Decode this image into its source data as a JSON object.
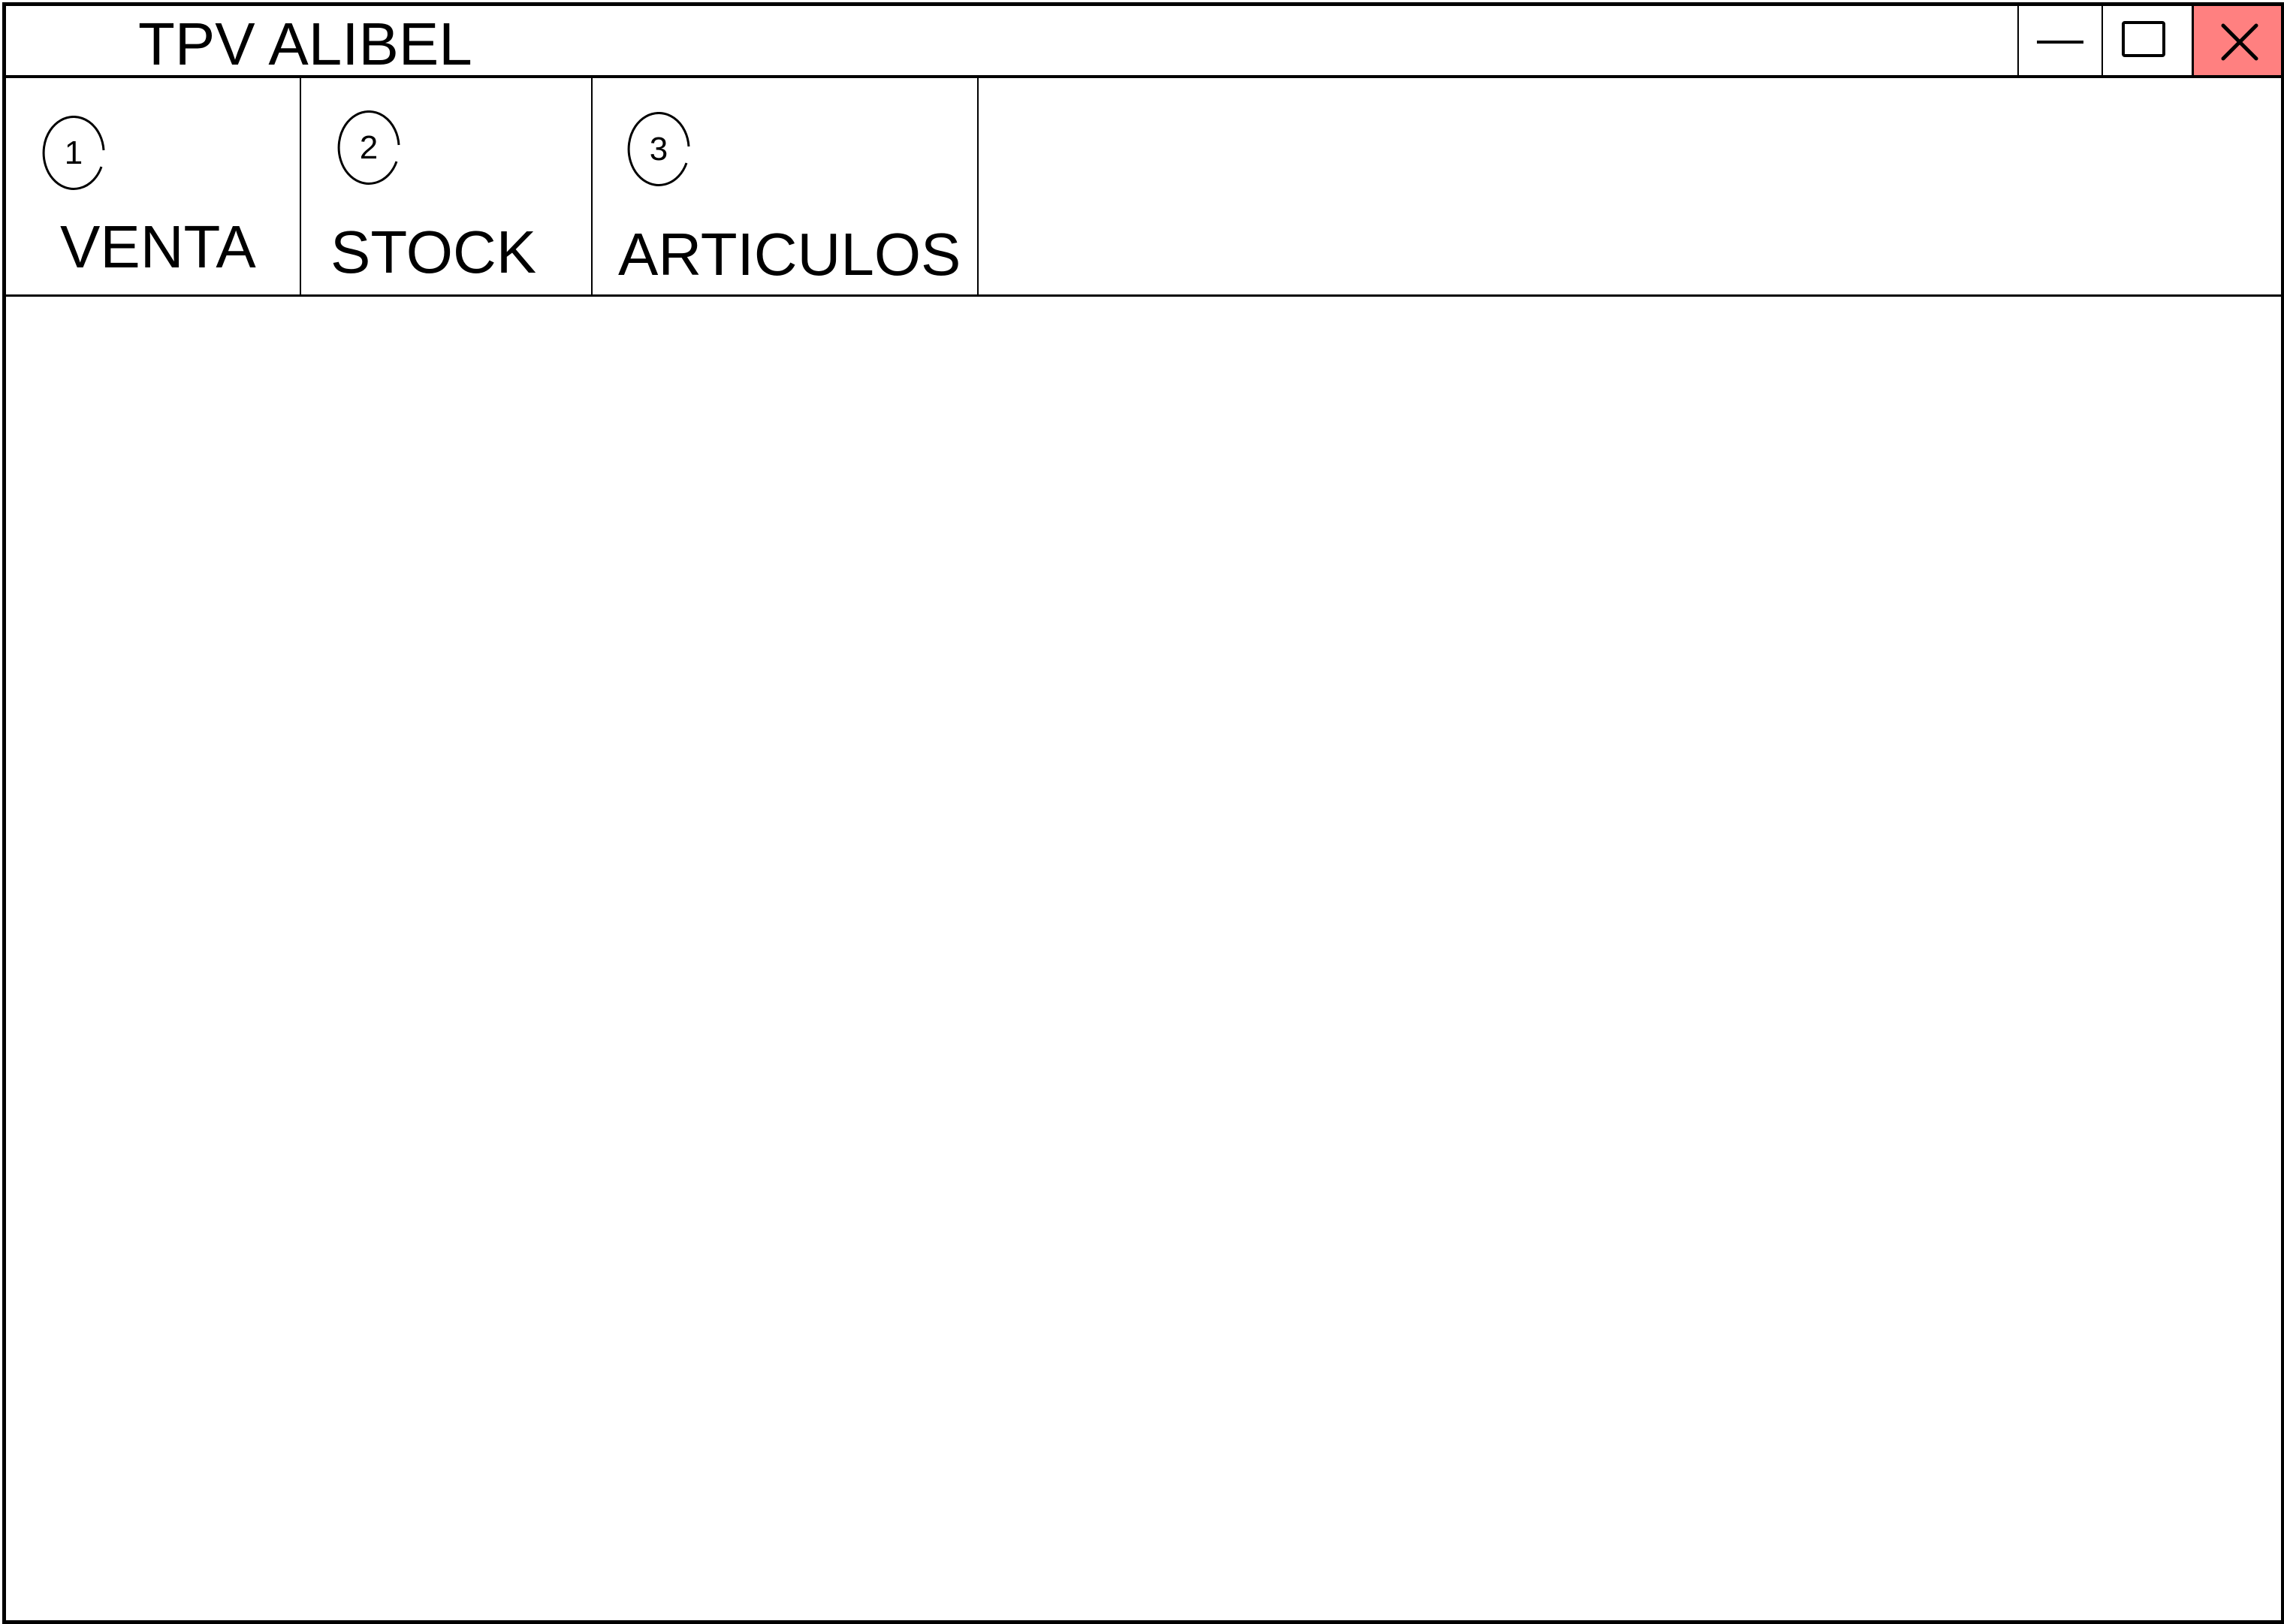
{
  "window": {
    "title": "TPV ALIBEL",
    "controls": {
      "minimize_icon": "minimize-icon",
      "maximize_icon": "maximize-icon",
      "close_icon": "close-icon",
      "close_color": "#ff8080"
    }
  },
  "tabs": [
    {
      "key": "1",
      "label": "VENTA"
    },
    {
      "key": "2",
      "label": "STOCK"
    },
    {
      "key": "3",
      "label": "ARTICULOS"
    }
  ]
}
